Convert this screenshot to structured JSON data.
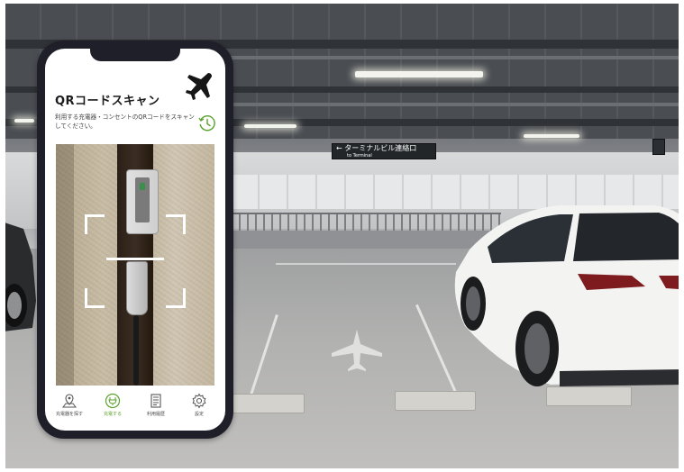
{
  "app": {
    "title": "QRコードスキャン",
    "description": "利用する充電器・コンセントのQRコードをスキャンしてください。",
    "icons": {
      "brand": "airplane-icon",
      "history": "clock-history-icon"
    },
    "accent_color": "#5aa02c",
    "phone_color": "#1f1f29"
  },
  "tabbar": {
    "items": [
      {
        "label": "充電器を探す",
        "icon": "map-pin-icon",
        "active": false
      },
      {
        "label": "充電する",
        "icon": "plug-charge-icon",
        "active": true
      },
      {
        "label": "利用履歴",
        "icon": "receipt-icon",
        "active": false
      },
      {
        "label": "設定",
        "icon": "gear-icon",
        "active": false
      }
    ]
  },
  "background": {
    "sign_text": "← ターミナルビル連絡口",
    "sign_subtext": "to Terminal"
  }
}
